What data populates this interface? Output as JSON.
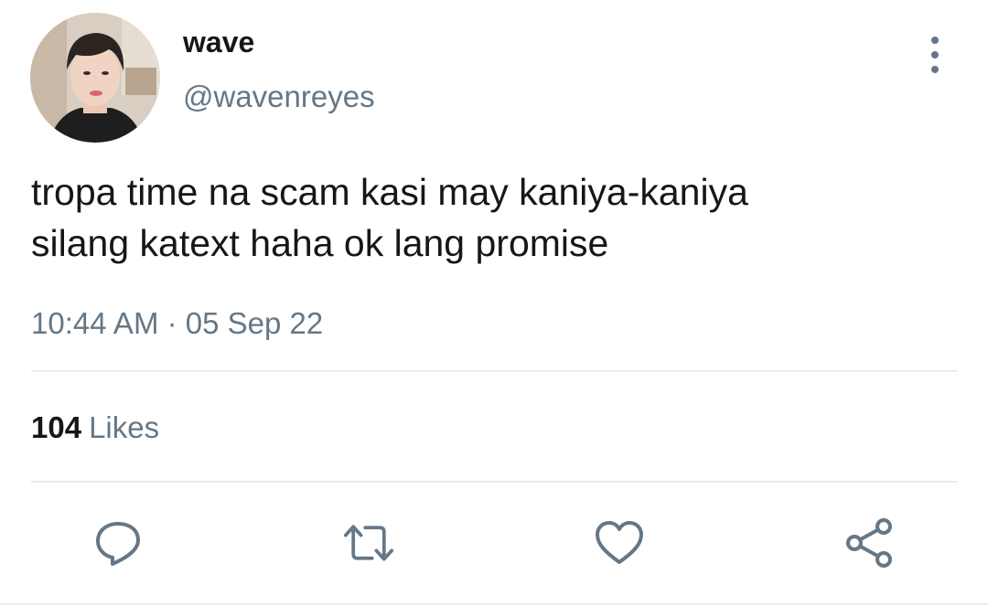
{
  "user": {
    "display_name": "wave",
    "handle": "@wavenreyes"
  },
  "tweet": {
    "text_line1": "tropa time na scam kasi may kaniya-kaniya",
    "text_line2": "silang katext haha ok lang promise",
    "time": "10:44 AM",
    "separator": "·",
    "date": "05 Sep 22"
  },
  "stats": {
    "likes_count": "104",
    "likes_label": "Likes"
  },
  "actions": [
    "reply-icon",
    "retweet-icon",
    "like-icon",
    "share-icon"
  ],
  "colors": {
    "text": "#14171a",
    "secondary": "#657786",
    "divider": "#e6ecf0",
    "icon": "#657786"
  }
}
